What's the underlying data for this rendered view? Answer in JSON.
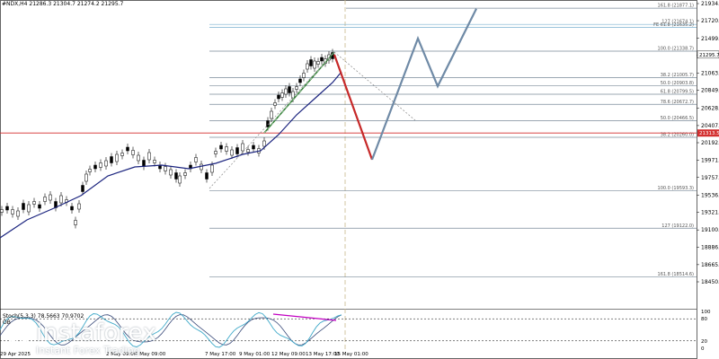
{
  "header": {
    "symbol_line": "#NDX,H4  21286.3 21304.7 21274.2 21295.7"
  },
  "indicator": {
    "stoch_label": "Stoch(5,3,3) 78.5663 70.9702",
    "ob_label": "OB"
  },
  "watermark": {
    "brand": "instaforex",
    "tagline": "Instant Forex Trading"
  },
  "chart_data": {
    "type": "candlestick",
    "symbol": "#NDX",
    "timeframe": "H4",
    "last_price": 21295.7,
    "current_level_label": "21313.5",
    "ylim": [
      18450.5,
      21934.5
    ],
    "y_ticks": [
      21934.5,
      21720.5,
      21499.0,
      21284.0,
      21063.5,
      20849.0,
      20628.0,
      20407.0,
      20192.5,
      19971.5,
      19757.0,
      19536.0,
      19321.5,
      19100.5,
      18886.0,
      18665.5,
      18450.5
    ],
    "x_labels": [
      "29 Apr 2025",
      "2 May 09:00",
      "6 May 09:00",
      "7 May 17:00",
      "9 May 01:00",
      "12 May 09:00",
      "13 May 17:00",
      "15 May 01:00"
    ],
    "fib_levels": [
      {
        "label": "161.8 (21877.1)",
        "value": 21877.1,
        "color": "#7a8a99"
      },
      {
        "label": "127 (21674.1)",
        "value": 21674.1,
        "color": "#7ab0d0"
      },
      {
        "label": "FE 61.8 (21635.2)",
        "value": 21635.2,
        "color": "#7ab0d0"
      },
      {
        "label": "100.0 (21338.7)",
        "value": 21338.7,
        "color": "#7a8a99"
      },
      {
        "label": "38.2 (21005.7)",
        "value": 21005.7,
        "color": "#7a8a99"
      },
      {
        "label": "50.0 (20903.8)",
        "value": 20903.8,
        "color": "#7a8a99"
      },
      {
        "label": "61.8 (20799.5)",
        "value": 20799.5,
        "color": "#7a8a99"
      },
      {
        "label": "78.6 (20672.7)",
        "value": 20672.7,
        "color": "#7a8a99"
      },
      {
        "label": "50.0 (20466.5)",
        "value": 20466.5,
        "color": "#7a8a99"
      },
      {
        "label": "38.2 (20260.0)",
        "value": 20260.0,
        "color": "#7a8a99"
      },
      {
        "label": "100.0 (19593.3)",
        "value": 19593.3,
        "color": "#7a8a99"
      },
      {
        "label": "127 (19122.0)",
        "value": 19122.0,
        "color": "#7a8a99"
      },
      {
        "label": "161.8 (18514.6)",
        "value": 18514.6,
        "color": "#7a8a99"
      }
    ],
    "red_level": 20313.5,
    "projection_red": [
      [
        21295.0
      ],
      [
        19980.0
      ]
    ],
    "projection_blue": [
      21498.0,
      20900.0,
      21870.0
    ],
    "stoch_levels": [
      100,
      80,
      20,
      0
    ],
    "colors": {
      "candle": "#000000",
      "ma": "#1a237e",
      "fib_grid": "#7a8a99",
      "red_level": "#d32f2f",
      "projection_red": "#c62828",
      "projection_blue": "#6f8aa6",
      "green_trend": "#2e7d32",
      "stoch_main": "#3fa9c9",
      "stoch_signal": "#3a4b7a",
      "divergence": "#c100c1",
      "price_label_bg": "#d32f2f"
    }
  }
}
